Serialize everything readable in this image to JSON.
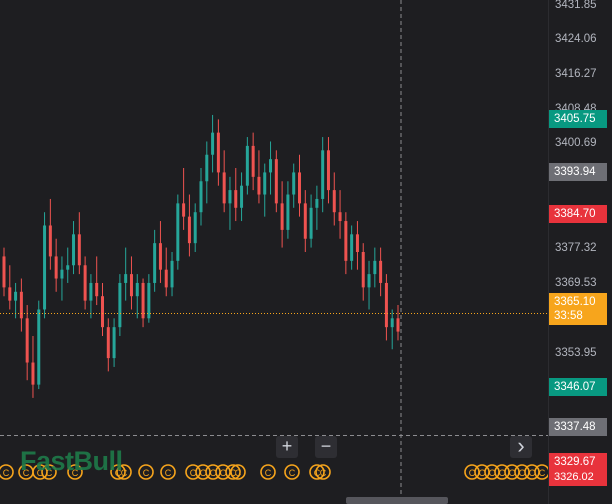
{
  "logo": {
    "text": "FastBull"
  },
  "controls": {
    "zoom_in": "+",
    "zoom_out": "−",
    "scroll_right": "›"
  },
  "axis": {
    "ticks": [
      "3431.85",
      "3424.06",
      "3416.27",
      "3408.48",
      "3400.69",
      "3377.32",
      "3369.53",
      "3353.95"
    ]
  },
  "price_tags": {
    "ask": {
      "label": "3405.75",
      "color": "#089981"
    },
    "prev": {
      "label": "3393.94",
      "color": "#6e6f75"
    },
    "bid": {
      "label": "3384.70",
      "color": "#e8333c"
    },
    "current": {
      "label": "3365.10",
      "sub": "33:58",
      "color": "#f7a51c"
    },
    "low": {
      "label": "3346.07",
      "color": "#089981"
    },
    "crosshair": {
      "label": "3337.48",
      "color": "#6e6f75"
    },
    "red_low": {
      "label": "3329.67",
      "color": "#e8333c"
    },
    "red_low2": {
      "label": "3326.02",
      "color": "#e8333c"
    }
  },
  "colors": {
    "up": "#26a69a",
    "down": "#ef5350",
    "background": "#1e1e21",
    "current_line": "#f7a51c",
    "event_marker": "#f7a51c"
  },
  "event_marker": {
    "glyph": "C"
  },
  "chart_data": {
    "type": "candlestick",
    "y_axis": {
      "min": 3322,
      "max": 3436
    },
    "current_price": 3365.1,
    "crosshair_price": 3337.48,
    "crosshair_x_index": 80,
    "candles": [
      [
        3378,
        3380,
        3369,
        3371
      ],
      [
        3371,
        3376,
        3366,
        3368
      ],
      [
        3368,
        3372,
        3364,
        3370
      ],
      [
        3370,
        3373,
        3361,
        3364
      ],
      [
        3364,
        3367,
        3350,
        3354
      ],
      [
        3354,
        3360,
        3346,
        3349
      ],
      [
        3349,
        3368,
        3348,
        3366
      ],
      [
        3366,
        3388,
        3364,
        3385
      ],
      [
        3385,
        3391,
        3375,
        3378
      ],
      [
        3378,
        3382,
        3370,
        3373
      ],
      [
        3373,
        3378,
        3368,
        3375
      ],
      [
        3375,
        3380,
        3372,
        3376
      ],
      [
        3376,
        3386,
        3374,
        3383
      ],
      [
        3383,
        3388,
        3374,
        3376
      ],
      [
        3376,
        3378,
        3366,
        3368
      ],
      [
        3368,
        3374,
        3364,
        3372
      ],
      [
        3372,
        3378,
        3367,
        3369
      ],
      [
        3369,
        3372,
        3360,
        3362
      ],
      [
        3362,
        3364,
        3352,
        3355
      ],
      [
        3355,
        3364,
        3353,
        3362
      ],
      [
        3362,
        3374,
        3360,
        3372
      ],
      [
        3372,
        3380,
        3368,
        3374
      ],
      [
        3374,
        3378,
        3366,
        3369
      ],
      [
        3369,
        3374,
        3364,
        3372
      ],
      [
        3372,
        3373,
        3362,
        3364
      ],
      [
        3364,
        3374,
        3363,
        3372
      ],
      [
        3372,
        3384,
        3370,
        3381
      ],
      [
        3381,
        3386,
        3372,
        3375
      ],
      [
        3375,
        3380,
        3369,
        3371
      ],
      [
        3371,
        3379,
        3369,
        3377
      ],
      [
        3377,
        3392,
        3375,
        3390
      ],
      [
        3390,
        3398,
        3384,
        3387
      ],
      [
        3387,
        3392,
        3378,
        3381
      ],
      [
        3381,
        3390,
        3379,
        3388
      ],
      [
        3388,
        3398,
        3385,
        3395
      ],
      [
        3395,
        3404,
        3390,
        3401
      ],
      [
        3401,
        3410,
        3397,
        3406
      ],
      [
        3406,
        3409,
        3394,
        3397
      ],
      [
        3397,
        3402,
        3388,
        3390
      ],
      [
        3390,
        3396,
        3384,
        3393
      ],
      [
        3393,
        3398,
        3386,
        3389
      ],
      [
        3389,
        3397,
        3386,
        3394
      ],
      [
        3394,
        3405,
        3392,
        3403
      ],
      [
        3403,
        3406,
        3393,
        3396
      ],
      [
        3396,
        3402,
        3390,
        3392
      ],
      [
        3392,
        3399,
        3387,
        3397
      ],
      [
        3397,
        3404,
        3392,
        3400
      ],
      [
        3400,
        3402,
        3388,
        3390
      ],
      [
        3390,
        3395,
        3380,
        3384
      ],
      [
        3384,
        3395,
        3382,
        3392
      ],
      [
        3392,
        3399,
        3389,
        3397
      ],
      [
        3397,
        3401,
        3387,
        3390
      ],
      [
        3390,
        3393,
        3379,
        3382
      ],
      [
        3382,
        3392,
        3380,
        3389
      ],
      [
        3389,
        3394,
        3384,
        3391
      ],
      [
        3391,
        3405,
        3388,
        3402
      ],
      [
        3402,
        3405,
        3390,
        3393
      ],
      [
        3393,
        3397,
        3385,
        3388
      ],
      [
        3388,
        3393,
        3382,
        3386
      ],
      [
        3386,
        3388,
        3374,
        3377
      ],
      [
        3377,
        3385,
        3375,
        3383
      ],
      [
        3383,
        3386,
        3375,
        3379
      ],
      [
        3379,
        3381,
        3368,
        3371
      ],
      [
        3371,
        3377,
        3366,
        3374
      ],
      [
        3374,
        3380,
        3371,
        3377
      ],
      [
        3377,
        3380,
        3369,
        3372
      ],
      [
        3372,
        3374,
        3359,
        3362
      ],
      [
        3362,
        3366,
        3357,
        3364
      ],
      [
        3364,
        3367,
        3359,
        3361
      ]
    ]
  }
}
